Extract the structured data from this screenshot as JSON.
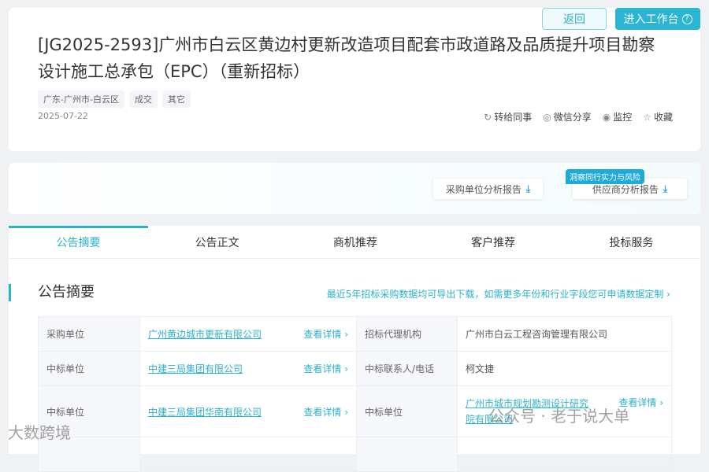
{
  "header": {
    "back_label": "返回",
    "workbench_label": "进入工作台",
    "help_icon": "?",
    "title": "[JG2025-2593]广州市白云区黄边村更新改造项目配套市政道路及品质提升项目勘察设计施工总承包（EPC）（重新招标）",
    "tags": [
      "广东-广州市-白云区",
      "成交",
      "其它"
    ],
    "date": "2025-07-22",
    "actions": [
      {
        "icon": "↻",
        "label": "转给同事"
      },
      {
        "icon": "◎",
        "label": "微信分享"
      },
      {
        "icon": "◉",
        "label": "监控"
      },
      {
        "icon": "☆",
        "label": "收藏"
      }
    ]
  },
  "reports": {
    "badge": "洞察同行实力与风险",
    "buyer_report": "采购单位分析报告",
    "supplier_report": "供应商分析报告",
    "download_icon": "⤓"
  },
  "tabs": [
    "公告摘要",
    "公告正文",
    "商机推荐",
    "客户推荐",
    "投标服务"
  ],
  "summary": {
    "heading": "公告摘要",
    "export_link": "最近5年招标采购数据均可导出下载，如需更多年份和行业字段您可申请数据定制 ›",
    "detail_label": "查看详情 ›",
    "rows": [
      {
        "label1": "采购单位",
        "value1": "广州黄边城市更新有限公司",
        "label2": "招标代理机构",
        "value2": "广州市白云工程咨询管理有限公司"
      },
      {
        "label1": "中标单位",
        "value1": "中建三局集团有限公司",
        "label2": "中标联系人/电话",
        "value2": "柯文捷"
      },
      {
        "label1": "中标单位",
        "value1": "中建三局集团华南有限公司",
        "label2": "中标单位",
        "value2": "广州市城市规划勘测设计研究院有限公司"
      }
    ]
  },
  "watermarks": {
    "left": "大数跨境",
    "right": "公众号 · 老于说大单"
  }
}
